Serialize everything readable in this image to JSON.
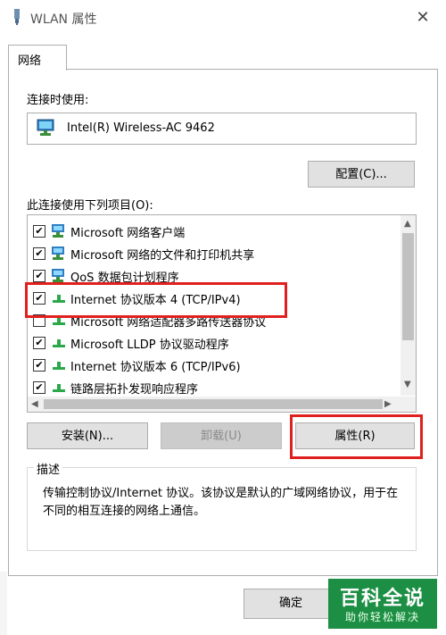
{
  "window": {
    "title": "WLAN 属性",
    "close": "✕"
  },
  "tabs": [
    {
      "label": "网络"
    }
  ],
  "connect_using": {
    "label": "连接时使用:",
    "adapter": "Intel(R) Wireless-AC 9462",
    "configure_button": "配置(C)..."
  },
  "items_section": {
    "label": "此连接使用下列项目(O):",
    "items": [
      {
        "label": "Microsoft 网络客户端",
        "checked": true,
        "icon": "network-client-icon"
      },
      {
        "label": "Microsoft 网络的文件和打印机共享",
        "checked": true,
        "icon": "file-share-icon"
      },
      {
        "label": "QoS 数据包计划程序",
        "checked": true,
        "icon": "qos-icon"
      },
      {
        "label": "Internet 协议版本 4 (TCP/IPv4)",
        "checked": true,
        "icon": "protocol-icon",
        "selected": true
      },
      {
        "label": "Microsoft 网络适配器多路传送器协议",
        "checked": false,
        "icon": "protocol-icon"
      },
      {
        "label": "Microsoft LLDP 协议驱动程序",
        "checked": true,
        "icon": "protocol-icon"
      },
      {
        "label": "Internet 协议版本 6 (TCP/IPv6)",
        "checked": true,
        "icon": "protocol-icon"
      },
      {
        "label": "链路层拓扑发现响应程序",
        "checked": true,
        "icon": "protocol-icon"
      }
    ]
  },
  "actions": {
    "install": "安装(N)...",
    "uninstall": "卸载(U)",
    "properties": "属性(R)"
  },
  "description": {
    "legend": "描述",
    "text": "传输控制协议/Internet 协议。该协议是默认的广域网络协议，用于在不同的相互连接的网络上通信。"
  },
  "footer": {
    "ok": "确定"
  },
  "watermark": {
    "main": "百科全说",
    "sub": "助你轻松解决"
  },
  "colors": {
    "highlight": "#e0201f",
    "watermark_bg": "#1c8f44"
  }
}
